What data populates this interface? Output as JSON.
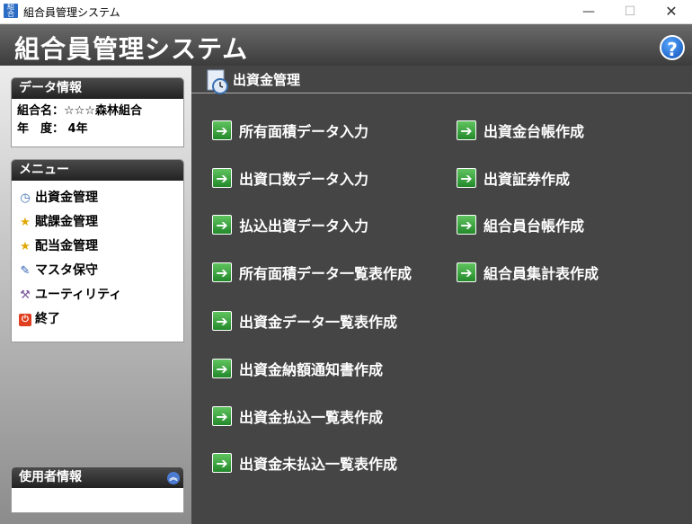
{
  "window": {
    "title": "組合員管理システム",
    "minimize": "—",
    "maximize": "☐",
    "close": "✕"
  },
  "header": {
    "app_title": "組合員管理システム",
    "help_label": "?"
  },
  "data_info": {
    "heading": "データ情報",
    "union_name": "組合名：☆☆☆森林組合",
    "year": "年　度：  4年"
  },
  "menu": {
    "heading": "メニュー",
    "items": [
      {
        "label": "出資金管理",
        "icon": "clock-icon"
      },
      {
        "label": "賦課金管理",
        "icon": "star-icon"
      },
      {
        "label": "配当金管理",
        "icon": "star-icon"
      },
      {
        "label": "マスタ保守",
        "icon": "edit-icon"
      },
      {
        "label": "ユーティリティ",
        "icon": "tools-icon"
      },
      {
        "label": "終了",
        "icon": "power-icon"
      }
    ]
  },
  "user_info": {
    "heading": "使用者情報"
  },
  "main": {
    "title": "出資金管理",
    "left_functions": [
      "所有面積データ入力",
      "出資口数データ入力",
      "払込出資データ入力",
      "所有面積データ一覧表作成",
      "出資金データ一覧表作成",
      "出資金納額通知書作成",
      "出資金払込一覧表作成",
      "出資金未払込一覧表作成"
    ],
    "right_functions": [
      "出資金台帳作成",
      "出資証券作成",
      "組合員台帳作成",
      "組合員集計表作成"
    ]
  },
  "colors": {
    "accent_green": "#2e9a35",
    "header_dark": "#3c3c3c",
    "content_bg": "#454545"
  }
}
